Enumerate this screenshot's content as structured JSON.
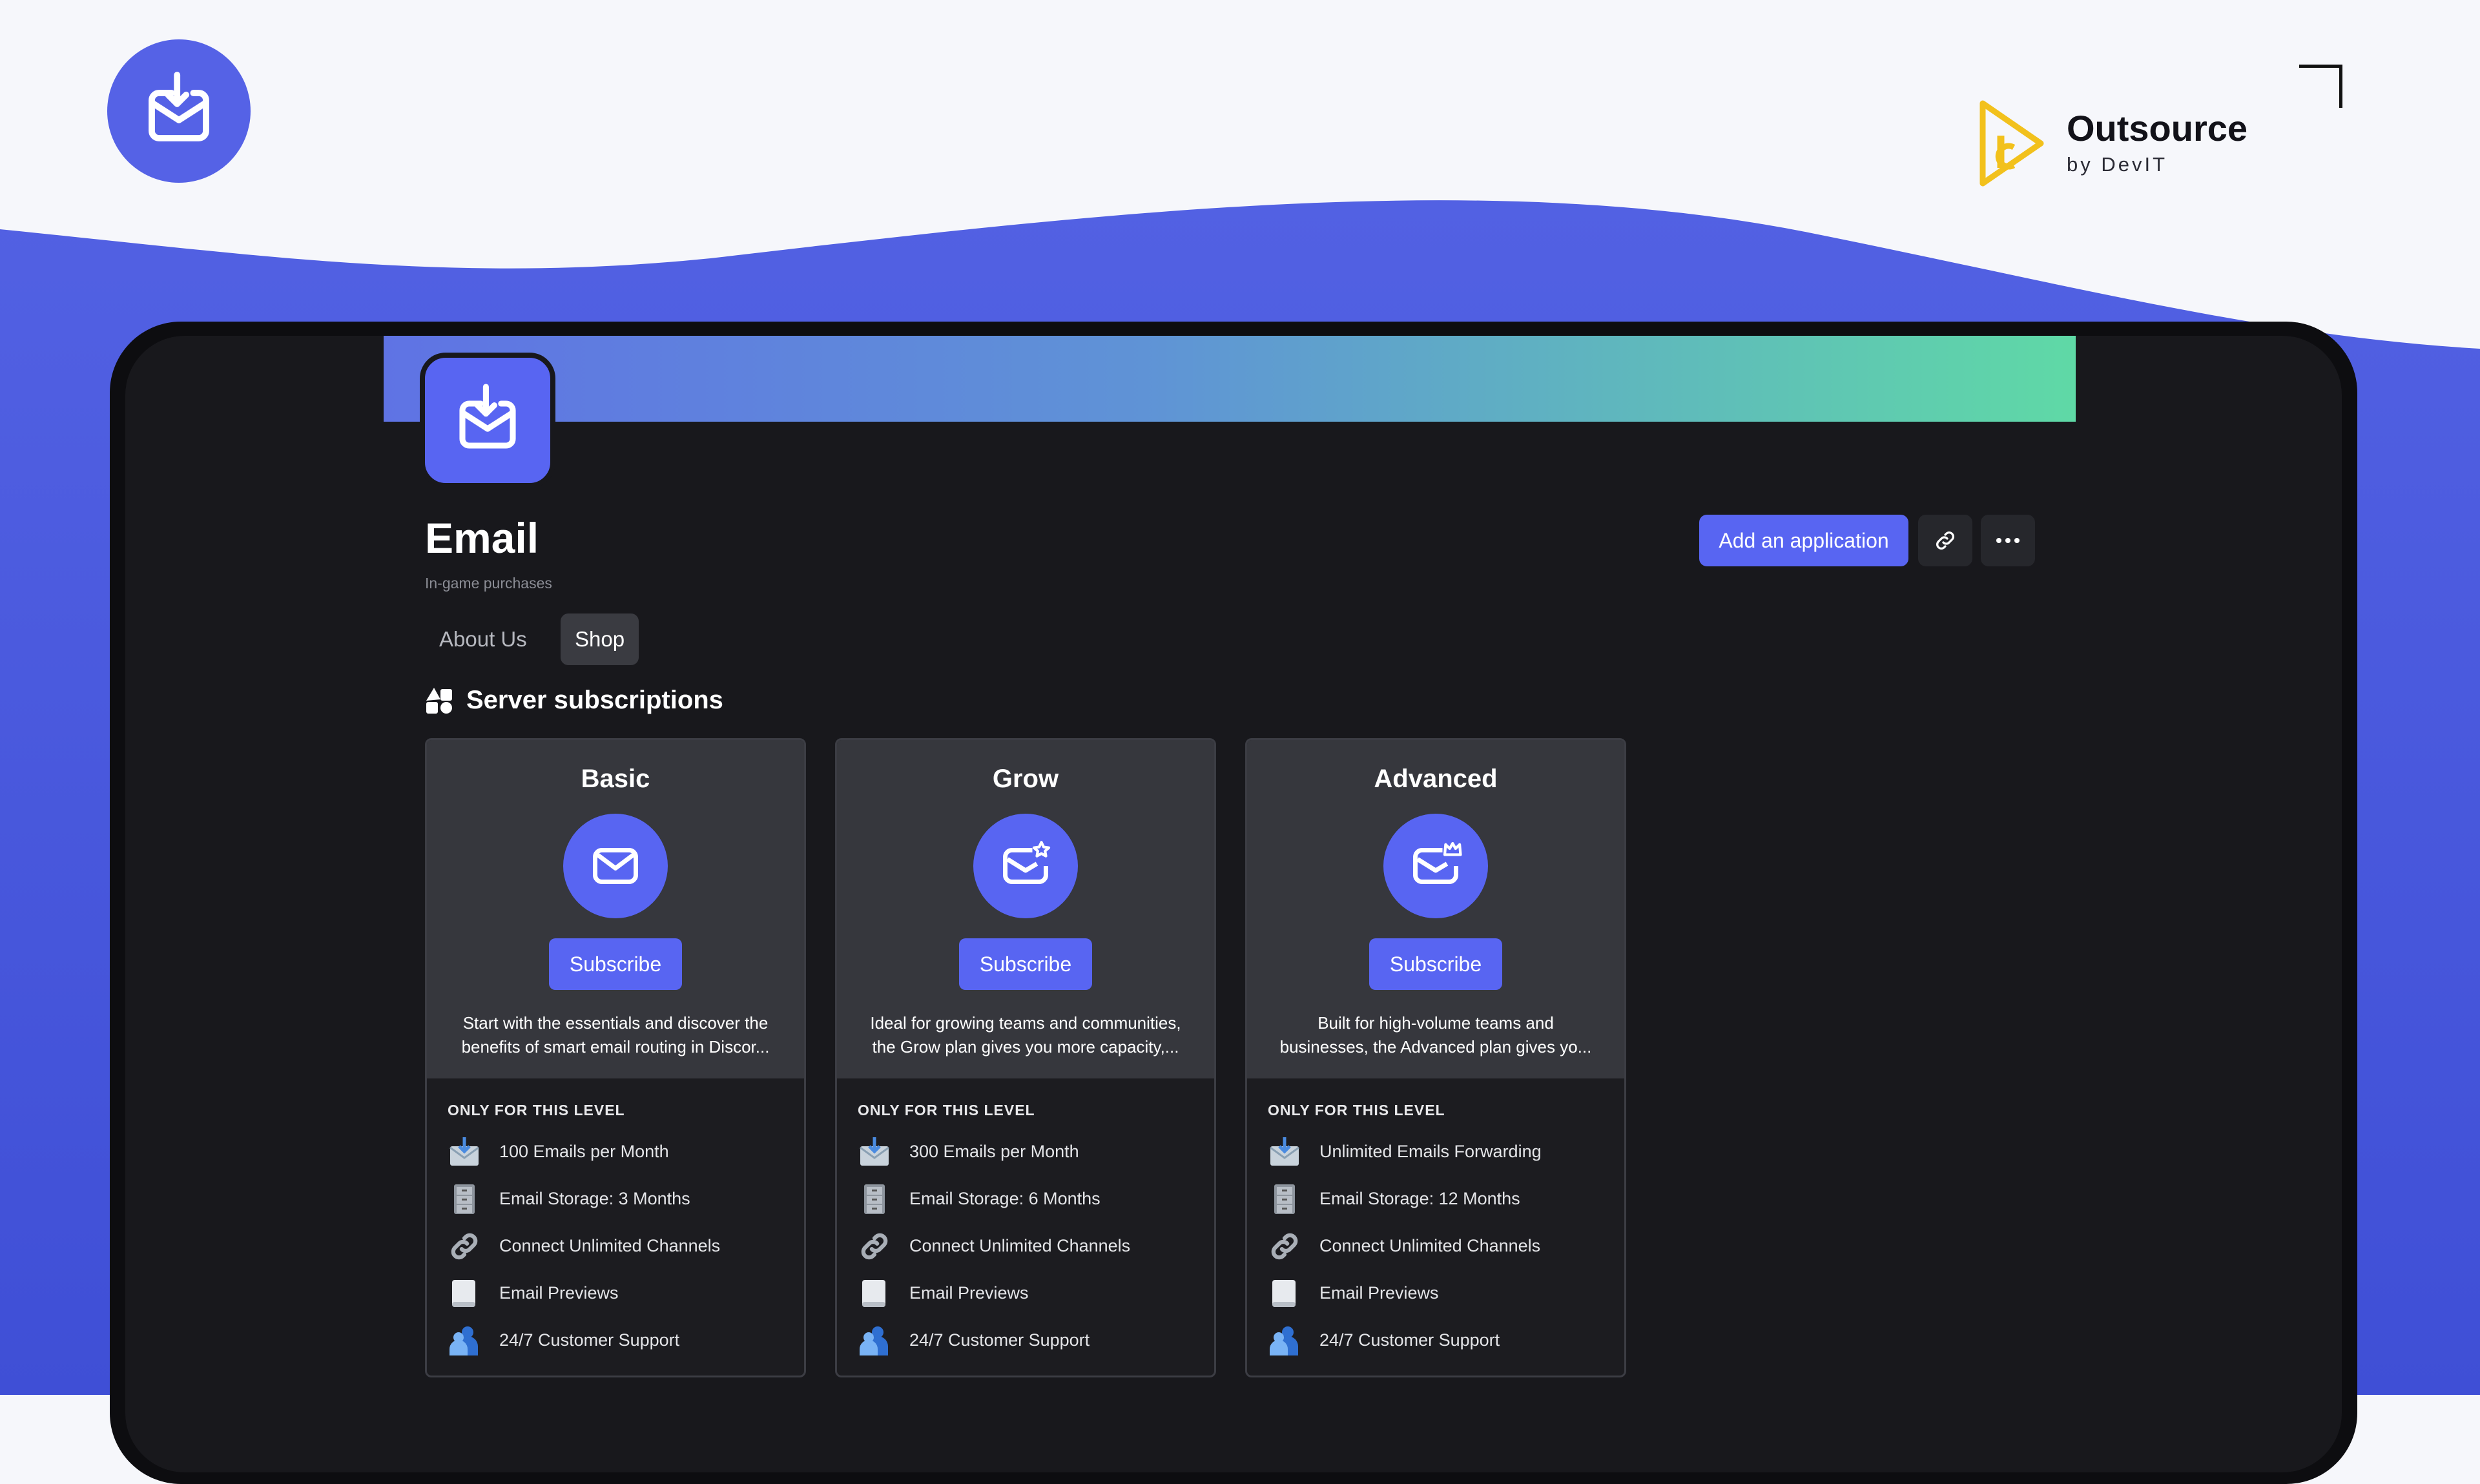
{
  "brand": {
    "title": "Outsource",
    "subtitle": "by DevIT"
  },
  "app": {
    "title": "Email",
    "subtitle": "In-game purchases"
  },
  "tabs": [
    {
      "label": "About Us"
    },
    {
      "label": "Shop"
    }
  ],
  "section": {
    "title": "Server subscriptions"
  },
  "header_actions": {
    "add_label": "Add an application"
  },
  "colors": {
    "accent": "#5865f2",
    "background": "#18181c",
    "card": "#36373d"
  },
  "cards": [
    {
      "name": "Basic",
      "icon": "envelope-icon",
      "subscribe_label": "Subscribe",
      "desc_line1": "Start with the essentials and discover the",
      "desc_line2": "benefits of smart email routing in Discor...",
      "level_label": "ONLY FOR THIS LEVEL",
      "perks": [
        {
          "icon": "incoming-mail-icon",
          "text": "100 Emails per Month"
        },
        {
          "icon": "file-cabinet-icon",
          "text": "Email Storage: 3 Months"
        },
        {
          "icon": "link-icon",
          "text": "Connect Unlimited Channels"
        },
        {
          "icon": "scroll-icon",
          "text": "Email Previews"
        },
        {
          "icon": "support-people-icon",
          "text": "24/7 Customer Support"
        }
      ]
    },
    {
      "name": "Grow",
      "icon": "envelope-star-icon",
      "subscribe_label": "Subscribe",
      "desc_line1": "Ideal for growing teams and communities,",
      "desc_line2": "the Grow plan gives you more capacity,...",
      "level_label": "ONLY FOR THIS LEVEL",
      "perks": [
        {
          "icon": "incoming-mail-icon",
          "text": "300 Emails per Month"
        },
        {
          "icon": "file-cabinet-icon",
          "text": "Email Storage: 6 Months"
        },
        {
          "icon": "link-icon",
          "text": "Connect Unlimited Channels"
        },
        {
          "icon": "scroll-icon",
          "text": "Email Previews"
        },
        {
          "icon": "support-people-icon",
          "text": "24/7 Customer Support"
        }
      ]
    },
    {
      "name": "Advanced",
      "icon": "envelope-crown-icon",
      "subscribe_label": "Subscribe",
      "desc_line1": "Built for high-volume teams and",
      "desc_line2": "businesses, the Advanced plan gives yo...",
      "level_label": "ONLY FOR THIS LEVEL",
      "perks": [
        {
          "icon": "incoming-mail-icon",
          "text": "Unlimited Emails Forwarding"
        },
        {
          "icon": "file-cabinet-icon",
          "text": "Email Storage: 12 Months"
        },
        {
          "icon": "link-icon",
          "text": "Connect Unlimited Channels"
        },
        {
          "icon": "scroll-icon",
          "text": "Email Previews"
        },
        {
          "icon": "support-people-icon",
          "text": "24/7 Customer Support"
        }
      ]
    }
  ]
}
